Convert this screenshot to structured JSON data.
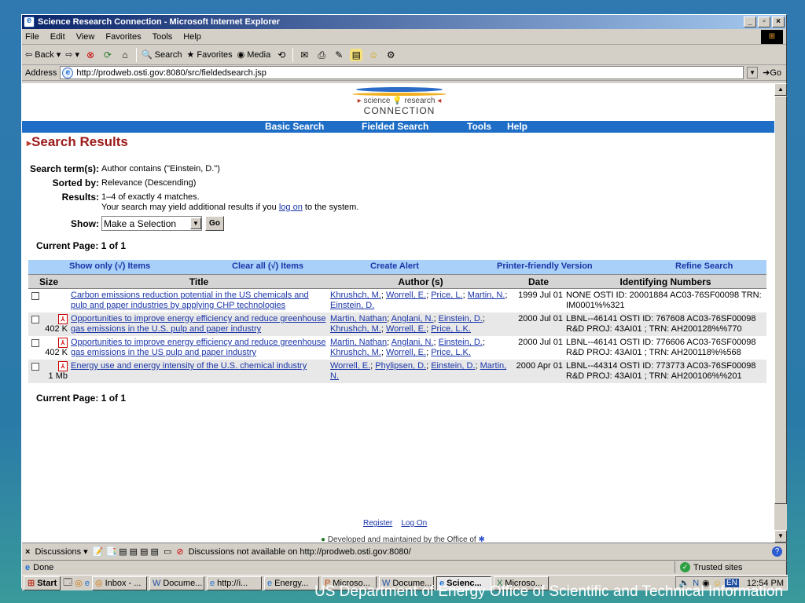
{
  "window": {
    "title": "Science Research Connection - Microsoft Internet Explorer"
  },
  "menu": [
    "File",
    "Edit",
    "View",
    "Favorites",
    "Tools",
    "Help"
  ],
  "toolbar": {
    "back": "Back",
    "search": "Search",
    "favorites": "Favorites",
    "media": "Media"
  },
  "address": {
    "label": "Address",
    "url": "http://prodweb.osti.gov:8080/src/fieldedsearch.jsp",
    "go": "Go"
  },
  "logo": {
    "line1": "science",
    "line1b": "research",
    "line2": "CONNECTION"
  },
  "nav": {
    "basic": "Basic Search",
    "fielded": "Fielded Search",
    "tools": "Tools",
    "help": "Help"
  },
  "page_title": "Search Results",
  "search": {
    "term_label": "Search term(s):",
    "term_value": "Author contains (\"Einstein, D.\")",
    "sorted_label": "Sorted by:",
    "sorted_value": "Relevance (Descending)",
    "results_label": "Results:",
    "results_value": "1–4 of exactly 4 matches.",
    "results_note_pre": "Your search may yield additional results if you",
    "results_note_link": "log on",
    "results_note_post": "to the system.",
    "show_label": "Show:",
    "show_value": "Make a Selection",
    "go_label": "Go"
  },
  "current_page": "Current Page: 1 of 1",
  "actions": {
    "show_only": "Show only (√) Items",
    "clear_all": "Clear all (√) Items",
    "create_alert": "Create Alert",
    "printer": "Printer-friendly Version",
    "refine": "Refine Search"
  },
  "columns": {
    "size": "Size",
    "title": "Title",
    "author": "Author (s)",
    "date": "Date",
    "ids": "Identifying Numbers"
  },
  "results": [
    {
      "size": "",
      "title": "Carbon emissions reduction potential in the US chemicals and pulp and paper industries by applying CHP technologies",
      "authors": [
        "Khrushch, M.",
        "Worrell, E.",
        "Price, L.",
        "Martin, N.",
        "Einstein, D."
      ],
      "date": "1999 Jul 01",
      "ids": "NONE OSTI ID: 20001884 AC03-76SF00098 TRN: IM0001%%321"
    },
    {
      "size": "402 K",
      "title": "Opportunities to improve energy efficiency and reduce greenhouse gas emissions in the U.S. pulp and paper industry",
      "authors": [
        "Martin, Nathan",
        "Anglani, N.",
        "Einstein, D.",
        "Khrushch, M.",
        "Worrell, E.",
        "Price, L.K."
      ],
      "date": "2000 Jul 01",
      "ids": "LBNL--46141 OSTI ID: 767608 AC03-76SF00098 R&D PROJ: 43AI01 ; TRN: AH200128%%770"
    },
    {
      "size": "402 K",
      "title": "Opportunities to improve energy efficiency and reduce greenhouse gas emissions in the US pulp and paper industry",
      "authors": [
        "Martin, Nathan",
        "Anglani, N.",
        "Einstein, D.",
        "Khrushch, M.",
        "Worrell, E.",
        "Price, L.K."
      ],
      "date": "2000 Jul 01",
      "ids": "LBNL--46141 OSTI ID: 776606 AC03-76SF00098 R&D PROJ: 43AI01 ; TRN: AH200118%%568"
    },
    {
      "size": "1 Mb",
      "title": "Energy use and energy intensity of the U.S. chemical industry",
      "authors": [
        "Worrell, E.",
        "Phylipsen, D.",
        "Einstein, D.",
        "Martin, N."
      ],
      "date": "2000 Apr 01",
      "ids": "LBNL--44314 OSTI ID: 773773 AC03-76SF00098 R&D PROJ: 43AI01 ; TRN: AH200106%%201"
    }
  ],
  "footer_links": {
    "register": "Register",
    "logon": "Log On"
  },
  "footer_text": "Developed and maintained by the Office of",
  "discussions": {
    "label": "Discussions",
    "status": "Discussions not available on http://prodweb.osti.gov:8080/"
  },
  "status": {
    "text": "Done",
    "zone": "Trusted sites"
  },
  "taskbar": {
    "start": "Start",
    "tasks": [
      "Inbox - ...",
      "Docume...",
      "http://i...",
      "Energy...",
      "Microso...",
      "Docume...",
      "Scienc...",
      "Microso..."
    ],
    "lang": "EN",
    "time": "12:54 PM"
  },
  "slide_caption": "US Department of Energy Office of Scientific and Technical Information"
}
